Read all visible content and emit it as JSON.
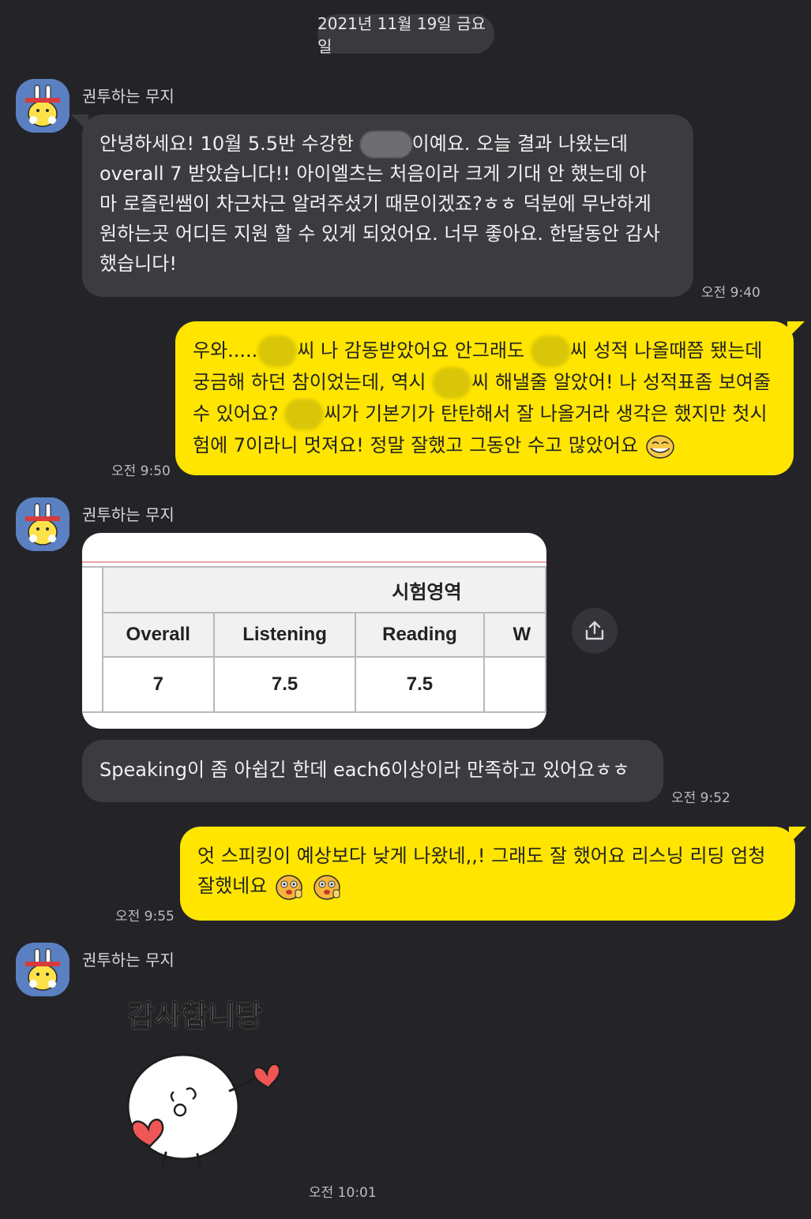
{
  "date": "2021년 11월 19일 금요일",
  "sender_name": "권투하는 무지",
  "messages": {
    "m1": {
      "l1a": "안녕하세요! 10월 5.5반 수강한",
      "l1b": "이예요. 오늘 결과 나왔는데",
      "l2": "overall 7 받았습니다!! 아이엘츠는 처음이라 크게 기대 안 했는데 아",
      "l3": "마 로즐린쌤이 차근차근 알려주셨기 때문이겠죠?ㅎㅎ 덕분에 무난하게",
      "l4": "원하는곳 어디든 지원 할 수 있게 되었어요. 너무 좋아요. 한달동안 감사",
      "l5": "했습니다!",
      "time": "오전 9:40"
    },
    "m2": {
      "l1a": "우와.....",
      "l1b": "씨 나 감동받았어요 안그래도",
      "l1c": "씨 성적 나올때쯤 됐는데",
      "l2a": "궁금해 하던 참이었는데, 역시",
      "l2b": "씨 해낼줄 알았어! 나 성적표좀 보여줄",
      "l3a": "수 있어요?",
      "l3b": "씨가 기본기가 탄탄해서 잘 나올거라 생각은 했지만 첫시",
      "l4": "험에 7이라니 멋져요! 정말 잘했고 그동안 수고 많았어요",
      "time": "오전 9:50"
    },
    "scorecard": {
      "section_header": "시험영역",
      "columns": [
        "Overall",
        "Listening",
        "Reading",
        "W"
      ],
      "values": [
        "7",
        "7.5",
        "7.5",
        ""
      ]
    },
    "m3": {
      "text": "Speaking이 좀 아쉽긴 한데 each6이상이라 만족하고 있어요ㅎㅎ",
      "time": "오전 9:52"
    },
    "m4": {
      "l1": "엇 스피킹이 예상보다 낮게 나왔네,,! 그래도 잘 했어요 리스닝 리딩 엄청",
      "l2": "잘했네요",
      "time": "오전 9:55"
    },
    "m5": {
      "sticker_text": "감사합니당",
      "time": "오전 10:01"
    }
  },
  "icons": {
    "share": "share-icon",
    "avatar": "muzi-avatar-icon"
  },
  "colors": {
    "background": "#242428",
    "incoming_bubble": "#3c3c40",
    "outgoing_bubble": "#ffe500"
  }
}
